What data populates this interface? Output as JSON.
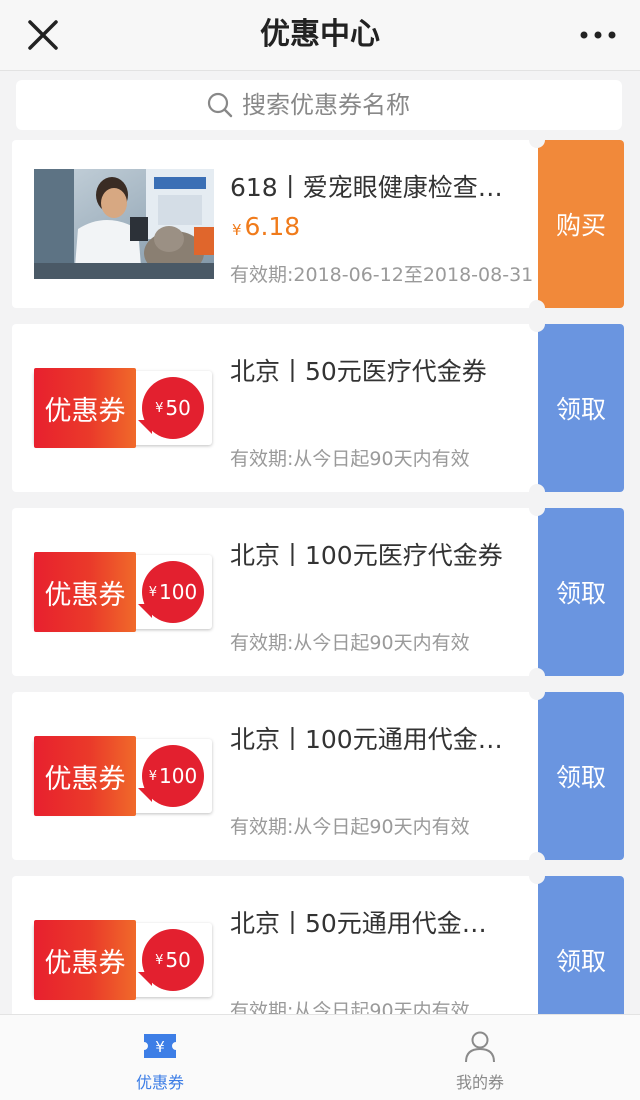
{
  "header": {
    "title": "优惠中心",
    "close_icon": "close-icon",
    "more_icon": "more-dots-icon"
  },
  "search": {
    "placeholder": "搜索优惠券名称",
    "value": ""
  },
  "colors": {
    "buy": "#f1893a",
    "claim": "#6a95e0",
    "price": "#f07b1b",
    "active_tab": "#3d7ee6"
  },
  "currency": "¥",
  "coupon_tag": "优惠券",
  "items": [
    {
      "title": "618丨爱宠眼健康检查…",
      "price": "6.18",
      "valid": "有效期:2018-06-12至2018-08-31",
      "button": "购买"
    },
    {
      "title": "北京丨50元医疗代金券",
      "badge": "50",
      "valid": "有效期:从今日起90天内有效",
      "button": "领取"
    },
    {
      "title": "北京丨100元医疗代金券",
      "badge": "100",
      "valid": "有效期:从今日起90天内有效",
      "button": "领取"
    },
    {
      "title": "北京丨100元通用代金…",
      "badge": "100",
      "valid": "有效期:从今日起90天内有效",
      "button": "领取"
    },
    {
      "title": "北京丨50元通用代金…",
      "badge": "50",
      "valid": "有效期:从今日起90天内有效",
      "button": "领取"
    }
  ],
  "tabs": [
    {
      "label": "优惠券",
      "icon": "coupon-icon",
      "active": true
    },
    {
      "label": "我的券",
      "icon": "user-icon",
      "active": false
    }
  ]
}
